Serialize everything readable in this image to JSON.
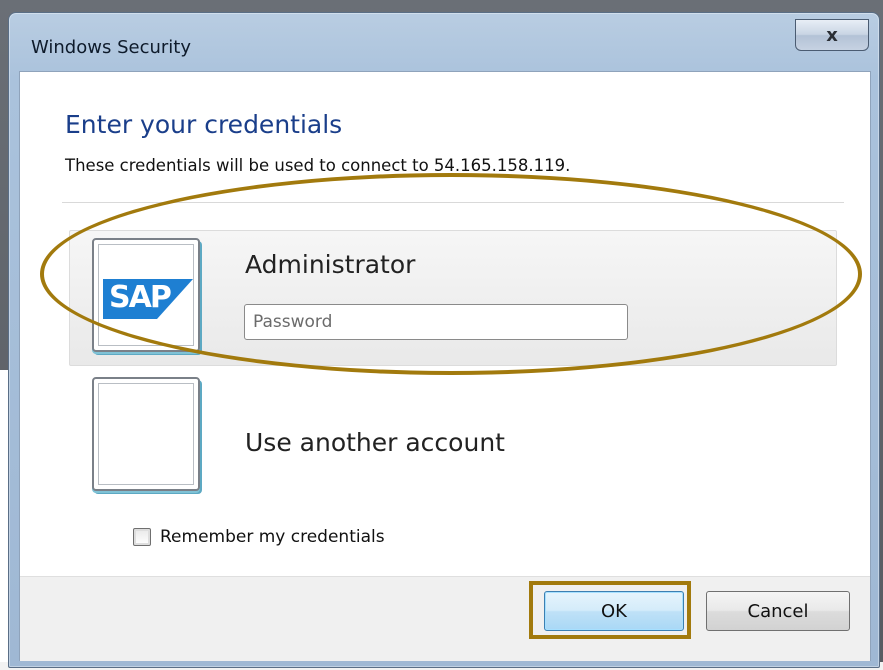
{
  "dialog": {
    "title": "Windows Security",
    "close_label": "x",
    "heading": "Enter your credentials",
    "subtext": "These credentials will be used to connect to 54.165.158.119.",
    "accounts": [
      {
        "name": "Administrator",
        "avatar_logo": "SAP",
        "password_placeholder": "Password",
        "selected": true
      },
      {
        "name": "Use another account",
        "selected": false
      }
    ],
    "remember_label": "Remember my credentials",
    "remember_checked": false,
    "ok_label": "OK",
    "cancel_label": "Cancel"
  },
  "colors": {
    "heading": "#1a3e8a",
    "annotation": "#a27a0d",
    "sap_blue": "#1e7fd2"
  },
  "icons": {
    "close": "close-icon",
    "avatar_sap": "sap-logo-icon",
    "avatar_blank": "user-tile-icon",
    "checkbox": "checkbox-icon"
  }
}
